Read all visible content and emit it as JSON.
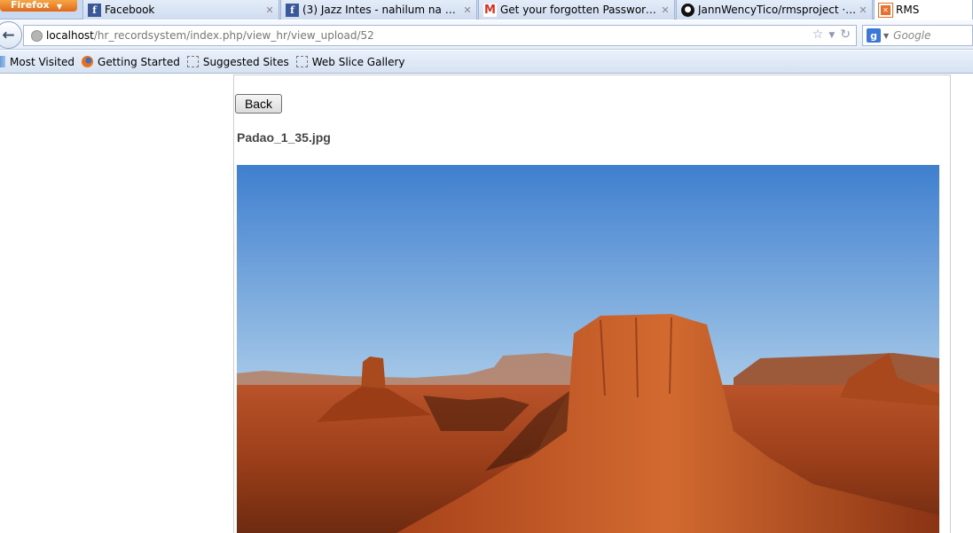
{
  "browser": {
    "app_button": "Firefox",
    "tabs": [
      {
        "label": "Facebook",
        "favicon": "facebook-icon",
        "active": false
      },
      {
        "label": "(3) Jazz Intes - nahilum na ang ...",
        "favicon": "facebook-icon",
        "active": false
      },
      {
        "label": "Get your forgotten Password - j...",
        "favicon": "gmail-icon",
        "active": false
      },
      {
        "label": "JannWencyTico/rmsproject · Git...",
        "favicon": "github-icon",
        "active": false
      },
      {
        "label": "RMS",
        "favicon": "rms-icon",
        "active": true
      }
    ],
    "url_host": "localhost",
    "url_path": "/hr_recordsystem/index.php/view_hr/view_upload/52",
    "search_placeholder": "Google",
    "bookmarks": [
      "Most Visited",
      "Getting Started",
      "Suggested Sites",
      "Web Slice Gallery"
    ]
  },
  "page": {
    "back_label": "Back",
    "file_name": "Padao_1_35.jpg",
    "image_description": "desert-monument-valley-photo"
  },
  "colors": {
    "accent_firefox": "#e8701c",
    "tabstrip": "#c9daf0"
  }
}
